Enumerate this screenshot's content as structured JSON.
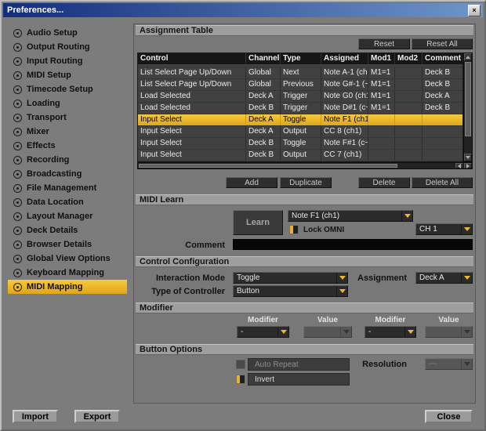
{
  "window": {
    "title": "Preferences...",
    "close_glyph": "×"
  },
  "sidebar": {
    "items": [
      {
        "label": "Audio Setup",
        "selected": false
      },
      {
        "label": "Output Routing",
        "selected": false
      },
      {
        "label": "Input Routing",
        "selected": false
      },
      {
        "label": "MIDI Setup",
        "selected": false
      },
      {
        "label": "Timecode Setup",
        "selected": false
      },
      {
        "label": "Loading",
        "selected": false
      },
      {
        "label": "Transport",
        "selected": false
      },
      {
        "label": "Mixer",
        "selected": false
      },
      {
        "label": "Effects",
        "selected": false
      },
      {
        "label": "Recording",
        "selected": false
      },
      {
        "label": "Broadcasting",
        "selected": false
      },
      {
        "label": "File Management",
        "selected": false
      },
      {
        "label": "Data Location",
        "selected": false
      },
      {
        "label": "Layout Manager",
        "selected": false
      },
      {
        "label": "Deck Details",
        "selected": false
      },
      {
        "label": "Browser Details",
        "selected": false
      },
      {
        "label": "Global View Options",
        "selected": false
      },
      {
        "label": "Keyboard Mapping",
        "selected": false
      },
      {
        "label": "MIDI Mapping",
        "selected": true
      }
    ],
    "import_label": "Import",
    "export_label": "Export"
  },
  "assignment_table": {
    "section_title": "Assignment Table",
    "reset_label": "Reset",
    "reset_all_label": "Reset All",
    "columns": [
      "Control",
      "Channel",
      "Type",
      "Assigned",
      "Mod1",
      "Mod2",
      "Comment"
    ],
    "rows": [
      {
        "control": "List Select Page Up/Down",
        "channel": "Global",
        "type": "Next",
        "assigned": "Note A-1 (ch~",
        "mod1": "M1=1",
        "mod2": "",
        "comment": "Deck B",
        "selected": false
      },
      {
        "control": "List Select Page Up/Down",
        "channel": "Global",
        "type": "Previous",
        "assigned": "Note G#-1 (~",
        "mod1": "M1=1",
        "mod2": "",
        "comment": "Deck B",
        "selected": false
      },
      {
        "control": "Load Selected",
        "channel": "Deck A",
        "type": "Trigger",
        "assigned": "Note G0 (ch1",
        "mod1": "M1=1",
        "mod2": "",
        "comment": "Deck A",
        "selected": false
      },
      {
        "control": "Load Selected",
        "channel": "Deck B",
        "type": "Trigger",
        "assigned": "Note D#1 (c~",
        "mod1": "M1=1",
        "mod2": "",
        "comment": "Deck B",
        "selected": false
      },
      {
        "control": "Input Select",
        "channel": "Deck A",
        "type": "Toggle",
        "assigned": "Note F1 (ch1)",
        "mod1": "",
        "mod2": "",
        "comment": "",
        "selected": true
      },
      {
        "control": "Input Select",
        "channel": "Deck A",
        "type": "Output",
        "assigned": "CC 8 (ch1)",
        "mod1": "",
        "mod2": "",
        "comment": "",
        "selected": false
      },
      {
        "control": "Input Select",
        "channel": "Deck B",
        "type": "Toggle",
        "assigned": "Note F#1 (c~",
        "mod1": "",
        "mod2": "",
        "comment": "",
        "selected": false
      },
      {
        "control": "Input Select",
        "channel": "Deck B",
        "type": "Output",
        "assigned": "CC 7 (ch1)",
        "mod1": "",
        "mod2": "",
        "comment": "",
        "selected": false
      }
    ],
    "add_label": "Add",
    "duplicate_label": "Duplicate",
    "delete_label": "Delete",
    "delete_all_label": "Delete All"
  },
  "midi_learn": {
    "section_title": "MIDI Learn",
    "learn_label": "Learn",
    "assignment_value": "Note F1 (ch1)",
    "lock_omni_label": "Lock OMNI",
    "channel_value": "CH 1",
    "comment_label": "Comment",
    "comment_value": ""
  },
  "control_configuration": {
    "section_title": "Control Configuration",
    "interaction_mode_label": "Interaction Mode",
    "interaction_mode_value": "Toggle",
    "assignment_label": "Assignment",
    "assignment_value": "Deck A",
    "type_of_controller_label": "Type of Controller",
    "type_of_controller_value": "Button"
  },
  "modifier": {
    "section_title": "Modifier",
    "labels": [
      "Modifier",
      "Value",
      "Modifier",
      "Value"
    ],
    "modifier1_value": "-",
    "value1_value": "",
    "modifier2_value": "-",
    "value2_value": ""
  },
  "button_options": {
    "section_title": "Button Options",
    "auto_repeat_label": "Auto Repeat",
    "resolution_label": "Resolution",
    "resolution_value": "---",
    "invert_label": "Invert"
  },
  "footer": {
    "close_label": "Close"
  }
}
